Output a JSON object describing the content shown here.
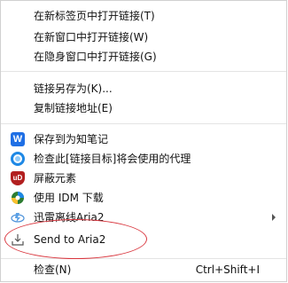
{
  "menu": {
    "open_links": [
      {
        "label": "在新标签页中打开链接(T)"
      },
      {
        "label": "在新窗口中打开链接(W)"
      },
      {
        "label": "在隐身窗口中打开链接(G)"
      }
    ],
    "save_links": [
      {
        "label": "链接另存为(K)..."
      },
      {
        "label": "复制链接地址(E)"
      }
    ],
    "extensions": [
      {
        "label": "保存到为知笔记",
        "icon": "wiz-note-icon"
      },
      {
        "label": "检查此[链接目标]将会使用的代理",
        "icon": "proxy-check-icon"
      },
      {
        "label": "屏蔽元素",
        "icon": "ublock-icon"
      },
      {
        "label": "使用 IDM 下载",
        "icon": "idm-icon"
      },
      {
        "label": "迅雷离线Aria2",
        "icon": "thunder-aria2-icon",
        "has_submenu": true
      },
      {
        "label": "Send to Aria2",
        "icon": "download-icon"
      }
    ],
    "inspect": {
      "label": "检查(N)",
      "shortcut": "Ctrl+Shift+I"
    }
  },
  "colors": {
    "highlight_circle": "#d9363e",
    "separator": "#e4e4e4",
    "wiz_blue": "#1f6fe5",
    "ublock_red": "#b21f1f"
  }
}
